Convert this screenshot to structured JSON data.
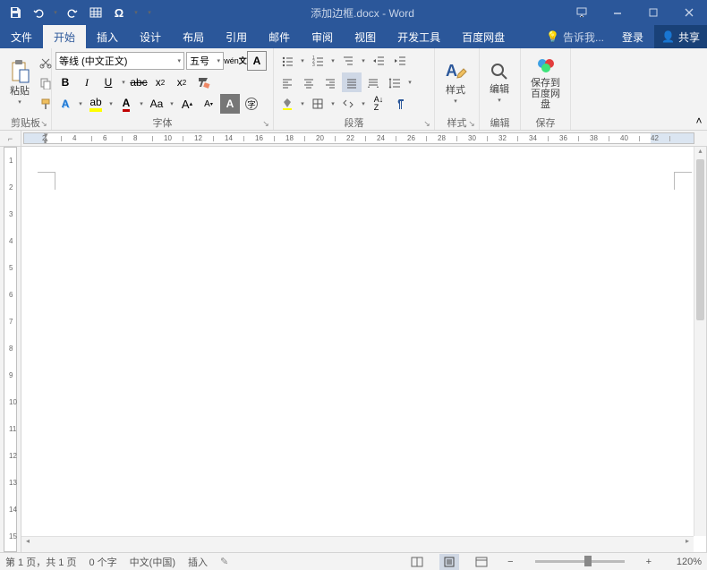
{
  "title": "添加边框.docx - Word",
  "tabs": [
    "文件",
    "开始",
    "插入",
    "设计",
    "布局",
    "引用",
    "邮件",
    "审阅",
    "视图",
    "开发工具",
    "百度网盘"
  ],
  "activeTab": 1,
  "tellMe": "告诉我...",
  "login": "登录",
  "share": "共享",
  "font": {
    "name": "等线 (中文正文)",
    "size": "五号"
  },
  "groups": {
    "clipboard": "剪贴板",
    "font": "字体",
    "paragraph": "段落",
    "styles": "样式",
    "editing": "编辑",
    "save": "保存"
  },
  "btns": {
    "paste": "粘贴",
    "styles": "样式",
    "editing": "编辑",
    "saveBaidu1": "保存到",
    "saveBaidu2": "百度网盘"
  },
  "ruler": {
    "marks": [
      2,
      4,
      6,
      8,
      10,
      12,
      14,
      16,
      18,
      20,
      22,
      24,
      26,
      28,
      30,
      32,
      34,
      36,
      38,
      40,
      42
    ],
    "vmarks": [
      1,
      2,
      3,
      4,
      5,
      6,
      7,
      8,
      9,
      10,
      11,
      12,
      13,
      14,
      15
    ]
  },
  "status": {
    "page": "第 1 页，共 1 页",
    "words": "0 个字",
    "lang": "中文(中国)",
    "mode": "插入",
    "zoom": "120%"
  }
}
